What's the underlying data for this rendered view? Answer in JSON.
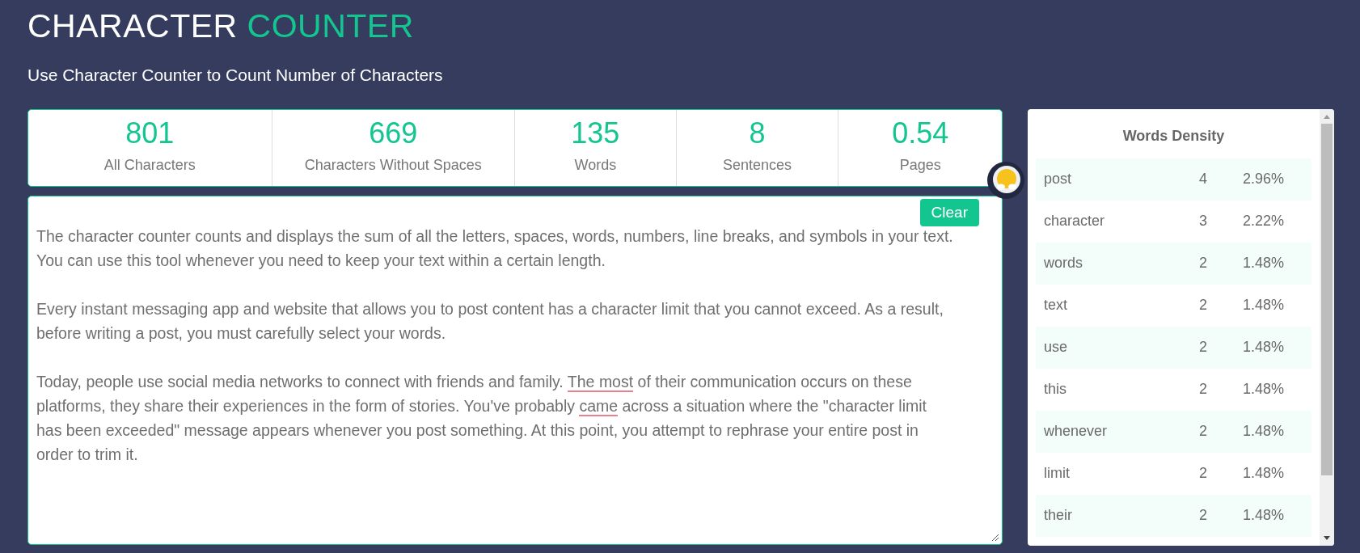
{
  "header": {
    "title": "CHARACTER",
    "title_accent": "COUNTER",
    "subtitle": "Use Character Counter to Count Number of Characters"
  },
  "stats": [
    {
      "value": "801",
      "label": "All Characters"
    },
    {
      "value": "669",
      "label": "Characters Without Spaces"
    },
    {
      "value": "135",
      "label": "Words"
    },
    {
      "value": "8",
      "label": "Sentences"
    },
    {
      "value": "0.54",
      "label": "Pages"
    }
  ],
  "editor": {
    "clear_button": "Clear",
    "paragraphs": [
      [
        {
          "text": "The character counter counts and displays the sum of all the letters, spaces, words, numbers, line breaks, and symbols in your text. You can use this tool whenever you need to keep your text within a certain length.",
          "flagged": false
        }
      ],
      [
        {
          "text": "Every instant messaging app and website that allows you to post content has a character limit that you cannot exceed. As a result, before writing a post, you must carefully select your words.",
          "flagged": false
        }
      ],
      [
        {
          "text": "Today, people use social media networks to connect with friends and family. ",
          "flagged": false
        },
        {
          "text": "The most",
          "flagged": true
        },
        {
          "text": " of their communication occurs on these platforms, they share their experiences in the form of stories. You've probably ",
          "flagged": false
        },
        {
          "text": "came",
          "flagged": true
        },
        {
          "text": " across a situation where the \"character limit has been exceeded\" message appears whenever you post something. At this point, you attempt to rephrase your entire post in order to trim it.",
          "flagged": false
        }
      ]
    ]
  },
  "density": {
    "title": "Words Density",
    "rows": [
      {
        "word": "post",
        "count": "4",
        "percent": "2.96%"
      },
      {
        "word": "character",
        "count": "3",
        "percent": "2.22%"
      },
      {
        "word": "words",
        "count": "2",
        "percent": "1.48%"
      },
      {
        "word": "text",
        "count": "2",
        "percent": "1.48%"
      },
      {
        "word": "use",
        "count": "2",
        "percent": "1.48%"
      },
      {
        "word": "this",
        "count": "2",
        "percent": "1.48%"
      },
      {
        "word": "whenever",
        "count": "2",
        "percent": "1.48%"
      },
      {
        "word": "limit",
        "count": "2",
        "percent": "1.48%"
      },
      {
        "word": "their",
        "count": "2",
        "percent": "1.48%"
      }
    ]
  }
}
